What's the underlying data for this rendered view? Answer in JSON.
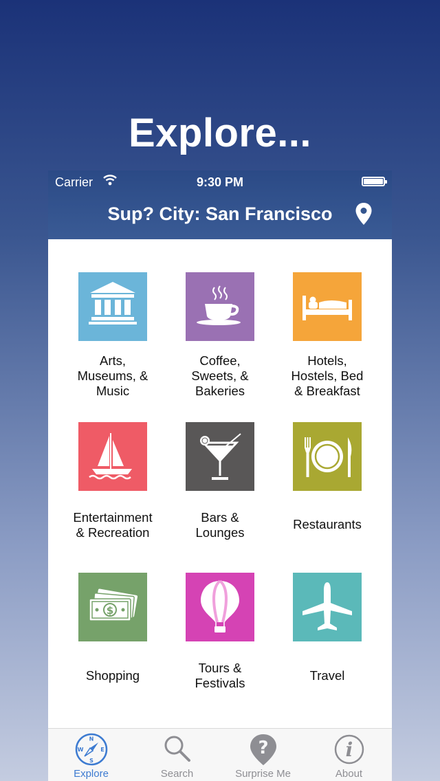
{
  "promo": {
    "headline": "Explore..."
  },
  "status_bar": {
    "carrier": "Carrier",
    "time": "9:30 PM"
  },
  "nav": {
    "title": "Sup? City:  San Francisco",
    "location_icon": "location-pin-icon"
  },
  "categories": [
    {
      "label_lines": [
        "Arts,",
        "Museums, &",
        "Music"
      ],
      "icon": "museum-icon",
      "color": "#6bb5d9"
    },
    {
      "label_lines": [
        "Coffee,",
        "Sweets, &",
        "Bakeries"
      ],
      "icon": "coffee-cup-icon",
      "color": "#9a71b3"
    },
    {
      "label_lines": [
        "Hotels,",
        "Hostels, Bed",
        "& Breakfast"
      ],
      "icon": "bed-icon",
      "color": "#f5a53a"
    },
    {
      "label_lines": [
        "Entertainment",
        "& Recreation"
      ],
      "icon": "sailboat-icon",
      "color": "#ef5b66"
    },
    {
      "label_lines": [
        "Bars &",
        "Lounges"
      ],
      "icon": "cocktail-icon",
      "color": "#595757"
    },
    {
      "label_lines": [
        "Restaurants"
      ],
      "icon": "plate-utensils-icon",
      "color": "#a9a832"
    },
    {
      "label_lines": [
        "Shopping"
      ],
      "icon": "money-icon",
      "color": "#76a26a"
    },
    {
      "label_lines": [
        "Tours &",
        "Festivals"
      ],
      "icon": "hot-air-balloon-icon",
      "color": "#d543b4"
    },
    {
      "label_lines": [
        "Travel"
      ],
      "icon": "airplane-icon",
      "color": "#5bb9b9"
    }
  ],
  "tabs": [
    {
      "label": "Explore",
      "icon": "compass-icon",
      "active": true
    },
    {
      "label": "Search",
      "icon": "magnifier-icon",
      "active": false
    },
    {
      "label": "Surprise Me",
      "icon": "question-pin-icon",
      "active": false
    },
    {
      "label": "About",
      "icon": "info-icon",
      "active": false
    }
  ],
  "colors": {
    "accent": "#3d7bd1",
    "nav_bar": "#2b4a86",
    "tab_inactive": "#8e8e93"
  }
}
